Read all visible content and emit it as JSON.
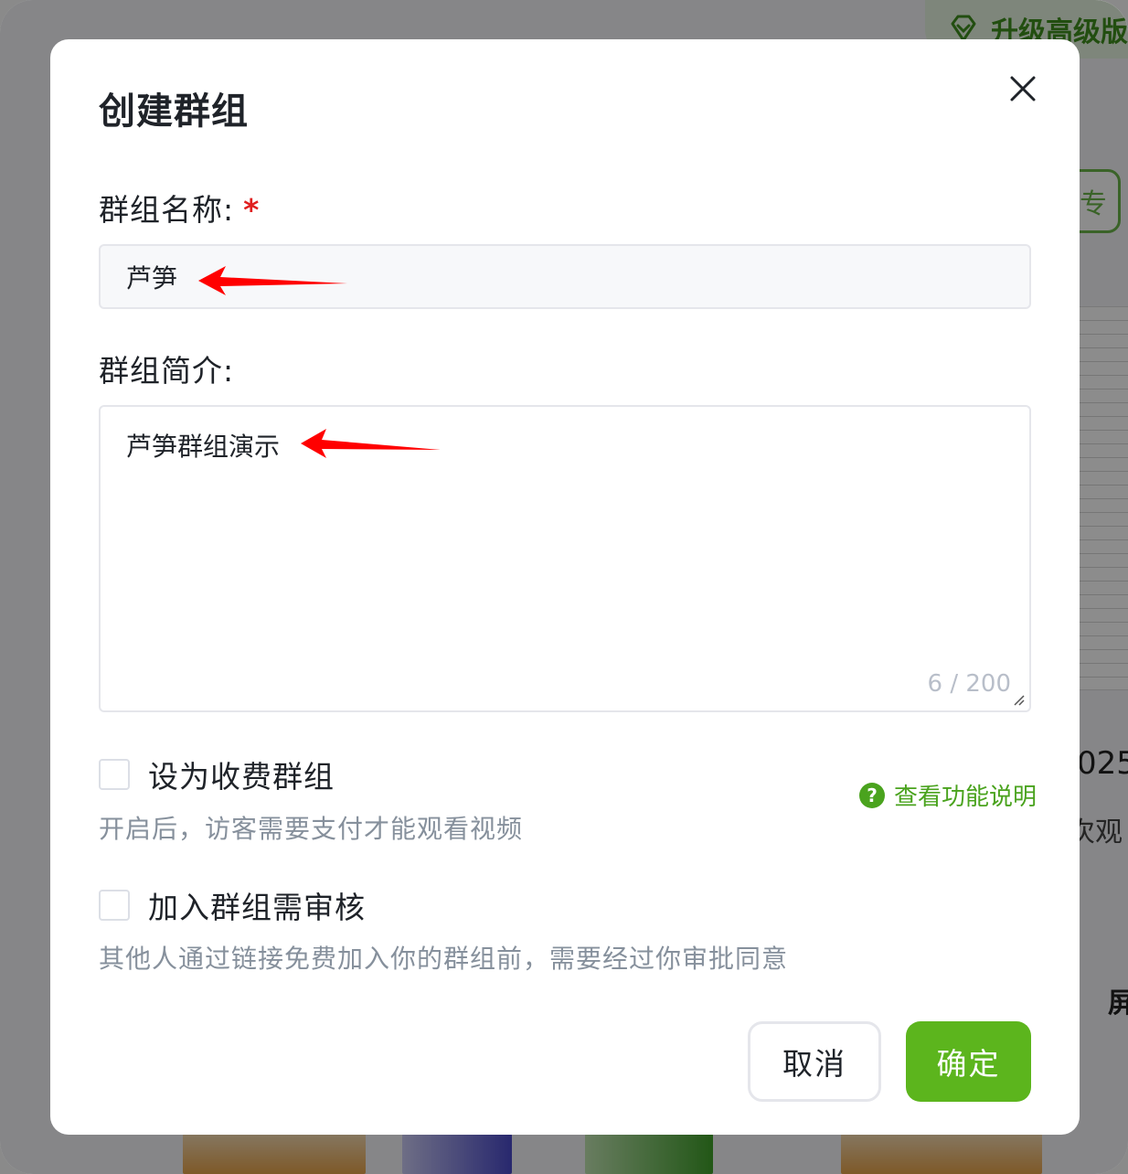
{
  "background": {
    "upgrade_label": "升级高级版",
    "outline_button_label": "专",
    "partial_text_1": "025",
    "partial_text_2": "次观",
    "partial_text_3": "屏"
  },
  "modal": {
    "title": "创建群组",
    "name_field": {
      "label": "群组名称:",
      "required_mark": "*",
      "value": "芦笋"
    },
    "description_field": {
      "label": "群组简介:",
      "value": "芦笋群组演示",
      "char_count": "6 / 200"
    },
    "paid_group": {
      "label": "设为收费群组",
      "checked": false,
      "hint": "开启后，访客需要支付才能观看视频"
    },
    "help_link": {
      "icon": "?",
      "label": "查看功能说明"
    },
    "approval": {
      "label": "加入群组需审核",
      "checked": false,
      "hint": "其他人通过链接免费加入你的群组前，需要经过你审批同意"
    },
    "buttons": {
      "cancel": "取消",
      "confirm": "确定"
    }
  },
  "colors": {
    "accent_green": "#5cb51d",
    "link_green": "#4aa31e",
    "required_red": "#e02020",
    "annotation_arrow": "#ff0000"
  }
}
